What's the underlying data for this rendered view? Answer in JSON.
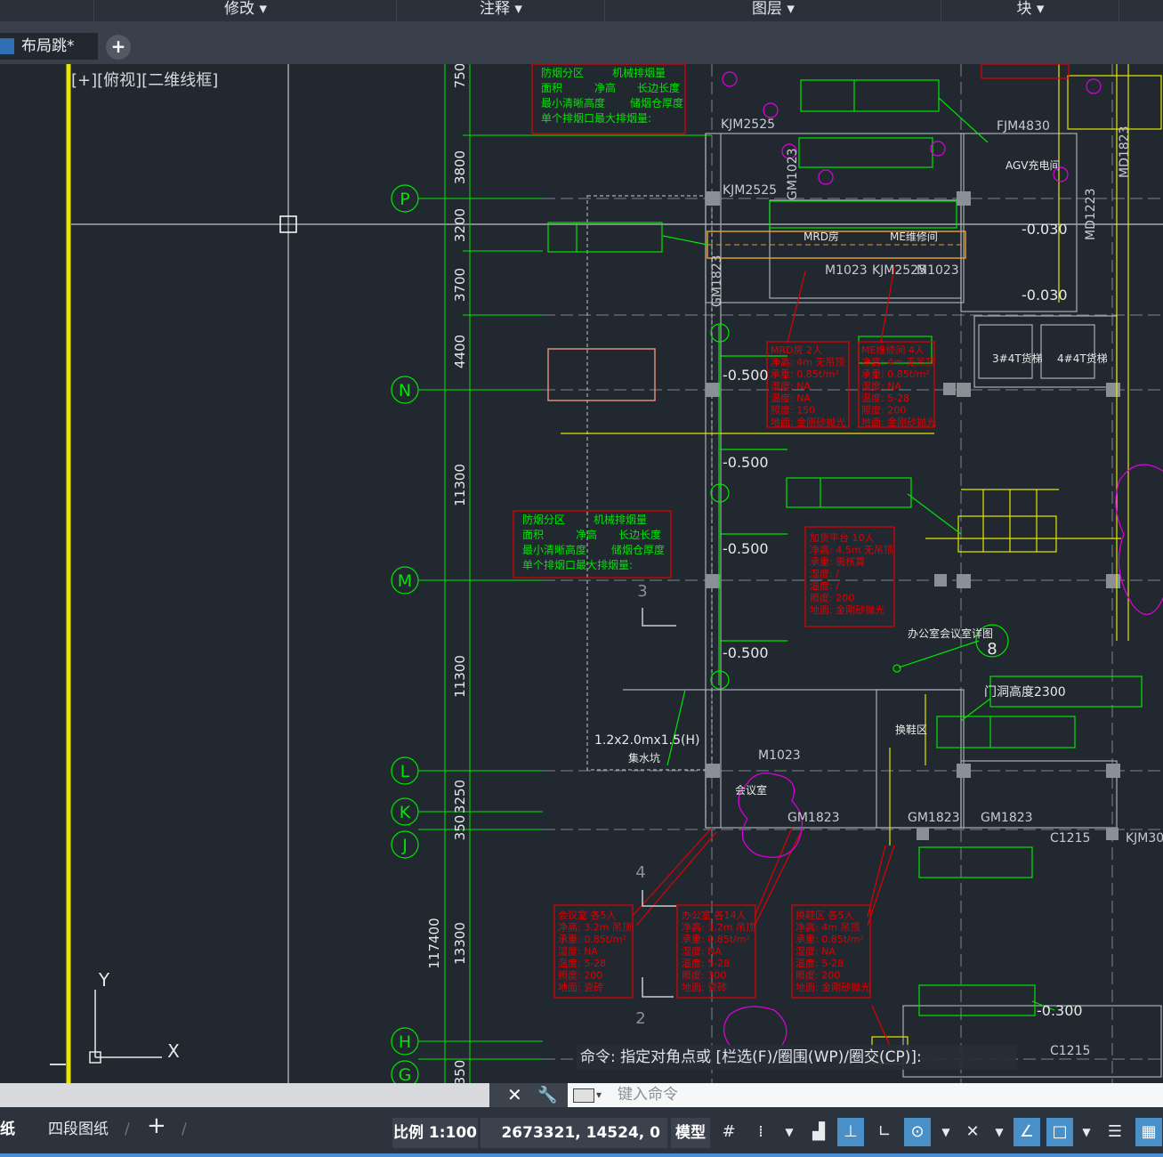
{
  "ribbon": {
    "items": [
      "修改 ▾",
      "注释 ▾",
      "图层 ▾",
      "块 ▾"
    ]
  },
  "tabs": {
    "document": "布局跳*",
    "add": "+"
  },
  "viewport": {
    "label": "[+][俯视][二维线框]",
    "ucs": {
      "x": "X",
      "y": "Y"
    }
  },
  "drawing": {
    "axis_labels": [
      "P",
      "N",
      "M",
      "L",
      "K",
      "J",
      "H",
      "G"
    ],
    "dims": [
      "750",
      "3800",
      "3200",
      "3700",
      "4400",
      "11300",
      "11300",
      "3250",
      "350",
      "13300",
      "117400",
      "350"
    ],
    "levels": [
      "-0.500",
      "-0.500",
      "-0.500",
      "-0.500",
      "-0.030",
      "-0.030",
      "-0.300"
    ],
    "door_tags": [
      "KJM2525",
      "KJM2525",
      "FJM4830",
      "M1023",
      "KJM2525",
      "M1023",
      "GM1823",
      "GM1823",
      "GM1823",
      "GM1823",
      "M1023",
      "C1215",
      "C1215",
      "KJM30",
      "MD1223",
      "MD1823",
      "GM1023"
    ],
    "rooms": [
      "MRD房",
      "ME维修间",
      "3#4T货梯",
      "4#4T货梯",
      "AGV充电间",
      "集水坑",
      "会议室",
      "换鞋区",
      "办公室会议室详图"
    ],
    "pit": "1.2x2.0mx1.5(H)",
    "door_height": "门洞高度2300",
    "notes_green": [
      [
        "防烟分区",
        "机械排烟量"
      ],
      [
        "面积",
        "净高",
        "长边长度"
      ],
      [
        "最小清晰高度",
        "储烟仓厚度"
      ],
      [
        "单个排烟口最大排烟量:"
      ]
    ],
    "notes_red_1": [
      "会议室 各5人",
      "净高: 3.2m 吊顶",
      "承重: 0.85t/m²",
      "湿度: NA",
      "温度: 5-28",
      "照度: 200",
      "地面: 瓷砖"
    ],
    "notes_red_2": [
      "办公室 各14人",
      "净高: 3.2m 吊顶",
      "承重: 0.85t/m²",
      "湿度: NA",
      "温度: 5-28",
      "照度: 300",
      "地面: 瓷砖"
    ],
    "notes_red_3": [
      "换鞋区 各5人",
      "净高: 4m 吊顶",
      "承重: 0.85t/m²",
      "湿度: NA",
      "温度: 5-28",
      "照度: 200",
      "地面: 金刚砂抛光"
    ],
    "notes_red_4": [
      "加货平台 10人",
      "净高: 4.5m 无吊顶",
      "承重: 需核算",
      "湿度: /",
      "温度: /",
      "照度: 200",
      "地面: 金刚砂抛光"
    ],
    "notes_red_5": [
      "MRD房 2人",
      "净高: 4m 无吊顶",
      "承重: 0.85t/m²",
      "湿度: NA",
      "温度: NA",
      "照度: 150",
      "地面: 金刚砂抛光"
    ],
    "notes_red_6": [
      "ME维修间 4人",
      "净高: 4m 无吊顶",
      "承重: 0.85t/m²",
      "湿度: NA",
      "温度: 5-28",
      "照度: 200",
      "地面: 金刚砂抛光"
    ],
    "section_marks": [
      "3",
      "4",
      "2",
      "8"
    ]
  },
  "command": {
    "prompt": "命令: 指定对角点或 [栏选(F)/圈围(WP)/圈交(CP)]:",
    "placeholder": "键入命令"
  },
  "status": {
    "layout_tabs": [
      "纸",
      "四段图纸"
    ],
    "scale": "比例 1:100",
    "coords": "2673321, 14524, 0",
    "model": "模型"
  },
  "colors": {
    "background": "#212830",
    "green": "#00e600",
    "red": "#e00000",
    "yellow": "#e6e600",
    "magenta": "#e000e0",
    "grey": "#a8adb3"
  }
}
